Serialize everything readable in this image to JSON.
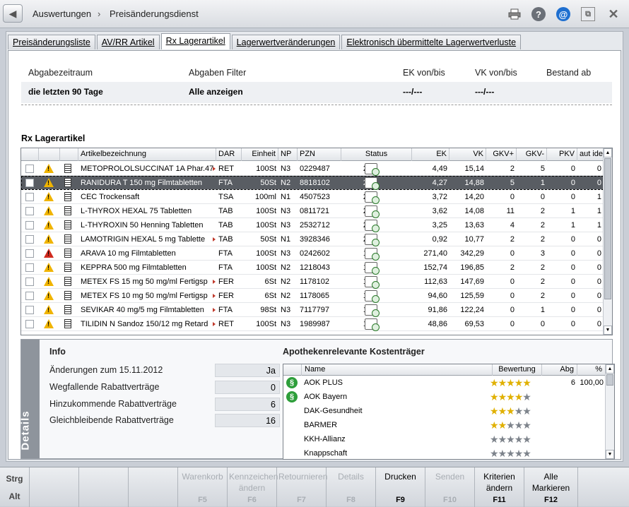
{
  "header": {
    "crumb1": "Auswertungen",
    "separator": "›",
    "crumb2": "Preisänderungsdienst",
    "icons": [
      "printer-icon",
      "help-icon",
      "email-icon",
      "window-icon",
      "close-icon"
    ]
  },
  "tabs": [
    {
      "label": "Preisänderungsliste",
      "active": false
    },
    {
      "label": "AV/RR Artikel",
      "active": false
    },
    {
      "label": "Rx Lagerartikel",
      "active": true
    },
    {
      "label": "Lagerwertveränderungen",
      "active": false
    },
    {
      "label": "Elektronisch übermittelte Lagerwertverluste",
      "active": false
    }
  ],
  "filter": {
    "labels": {
      "zeitraum": "Abgabezeitraum",
      "filter": "Abgaben Filter",
      "ek": "EK von/bis",
      "vk": "VK von/bis",
      "bestand": "Bestand ab"
    },
    "values": {
      "zeitraum": "die letzten 90 Tage",
      "filter": "Alle anzeigen",
      "ek": "---/---",
      "vk": "---/---",
      "bestand": ""
    }
  },
  "section_title": "Rx Lagerartikel",
  "columns": [
    "",
    "",
    "",
    "Artikelbezeichnung",
    "DAR",
    "Einheit",
    "NP",
    "PZN",
    "Status",
    "EK",
    "VK",
    "GKV+",
    "GKV-",
    "PKV",
    "aut idem"
  ],
  "rows": [
    {
      "name": "METOPROLOLSUCCINAT 1A Phar.47",
      "dar": "RET",
      "einheit": "100St",
      "np": "N3",
      "pzn": "0229487",
      "status": "2",
      "ek": "4,49",
      "vk": "15,14",
      "gkvp": "2",
      "gkvm": "5",
      "pkv": "0",
      "autidem": "0",
      "warn": "yellow",
      "truncated": true
    },
    {
      "name": "RANIDURA T 150 mg Filmtabletten",
      "dar": "FTA",
      "einheit": "50St",
      "np": "N2",
      "pzn": "8818102",
      "status": "2",
      "ek": "4,27",
      "vk": "14,88",
      "gkvp": "5",
      "gkvm": "1",
      "pkv": "0",
      "autidem": "0",
      "warn": "yellow",
      "selected": true
    },
    {
      "name": "CEC Trockensaft",
      "dar": "TSA",
      "einheit": "100ml",
      "np": "N1",
      "pzn": "4507523",
      "status": "2",
      "ek": "3,72",
      "vk": "14,20",
      "gkvp": "0",
      "gkvm": "0",
      "pkv": "0",
      "autidem": "1",
      "warn": "yellow"
    },
    {
      "name": "L-THYROX HEXAL 75 Tabletten",
      "dar": "TAB",
      "einheit": "100St",
      "np": "N3",
      "pzn": "0811721",
      "status": "2",
      "ek": "3,62",
      "vk": "14,08",
      "gkvp": "11",
      "gkvm": "2",
      "pkv": "1",
      "autidem": "1",
      "warn": "yellow"
    },
    {
      "name": "L-THYROXIN 50 Henning Tabletten",
      "dar": "TAB",
      "einheit": "100St",
      "np": "N3",
      "pzn": "2532712",
      "status": "2",
      "ek": "3,25",
      "vk": "13,63",
      "gkvp": "4",
      "gkvm": "2",
      "pkv": "1",
      "autidem": "1",
      "warn": "yellow"
    },
    {
      "name": "LAMOTRIGIN HEXAL 5 mg Tablette",
      "dar": "TAB",
      "einheit": "50St",
      "np": "N1",
      "pzn": "3928346",
      "status": "2",
      "ek": "0,92",
      "vk": "10,77",
      "gkvp": "2",
      "gkvm": "2",
      "pkv": "0",
      "autidem": "0",
      "warn": "yellow",
      "truncated": true
    },
    {
      "name": "ARAVA 10 mg Filmtabletten",
      "dar": "FTA",
      "einheit": "100St",
      "np": "N3",
      "pzn": "0242602",
      "status": "1",
      "ek": "271,40",
      "vk": "342,29",
      "gkvp": "0",
      "gkvm": "3",
      "pkv": "0",
      "autidem": "0",
      "warn": "red"
    },
    {
      "name": "KEPPRA 500 mg Filmtabletten",
      "dar": "FTA",
      "einheit": "100St",
      "np": "N2",
      "pzn": "1218043",
      "status": "1",
      "ek": "152,74",
      "vk": "196,85",
      "gkvp": "2",
      "gkvm": "2",
      "pkv": "0",
      "autidem": "0",
      "warn": "yellow"
    },
    {
      "name": "METEX FS 15 mg 50 mg/ml Fertigsp",
      "dar": "FER",
      "einheit": "6St",
      "np": "N2",
      "pzn": "1178102",
      "status": "1",
      "ek": "112,63",
      "vk": "147,69",
      "gkvp": "0",
      "gkvm": "2",
      "pkv": "0",
      "autidem": "0",
      "warn": "yellow",
      "truncated": true
    },
    {
      "name": "METEX FS 10 mg 50 mg/ml Fertigsp",
      "dar": "FER",
      "einheit": "6St",
      "np": "N2",
      "pzn": "1178065",
      "status": "1",
      "ek": "94,60",
      "vk": "125,59",
      "gkvp": "0",
      "gkvm": "2",
      "pkv": "0",
      "autidem": "0",
      "warn": "yellow",
      "truncated": true
    },
    {
      "name": "SEVIKAR 40 mg/5 mg Filmtabletten",
      "dar": "FTA",
      "einheit": "98St",
      "np": "N3",
      "pzn": "7117797",
      "status": "1",
      "ek": "91,86",
      "vk": "122,24",
      "gkvp": "0",
      "gkvm": "1",
      "pkv": "0",
      "autidem": "0",
      "warn": "yellow",
      "truncated": true
    },
    {
      "name": "TILIDIN N Sandoz 150/12 mg Retard",
      "dar": "RET",
      "einheit": "100St",
      "np": "N3",
      "pzn": "1989987",
      "status": "1",
      "ek": "48,86",
      "vk": "69,53",
      "gkvp": "0",
      "gkvm": "0",
      "pkv": "0",
      "autidem": "0",
      "warn": "yellow",
      "truncated": true
    }
  ],
  "details": {
    "side_label": "Details",
    "info_title": "Info",
    "items": [
      {
        "label": "Änderungen zum 15.11.2012",
        "value": "Ja"
      },
      {
        "label": "Wegfallende Rabattverträge",
        "value": "0"
      },
      {
        "label": "Hinzukommende Rabattverträge",
        "value": "6"
      },
      {
        "label": "Gleichbleibende Rabattverträge",
        "value": "16"
      }
    ],
    "kt_title": "Apothekenrelevante Kostenträger",
    "kt_columns": [
      "",
      "Name",
      "Bewertung",
      "Abg",
      "%"
    ],
    "kt_rows": [
      {
        "name": "AOK PLUS",
        "stars": 5,
        "abg": "6",
        "pct": "100,00",
        "icon": true
      },
      {
        "name": "AOK Bayern",
        "stars": 4,
        "abg": "",
        "pct": "",
        "icon": true
      },
      {
        "name": "DAK-Gesundheit",
        "stars": 3,
        "abg": "",
        "pct": "",
        "icon": false
      },
      {
        "name": "BARMER",
        "stars": 2,
        "abg": "",
        "pct": "",
        "icon": false
      },
      {
        "name": "KKH-Allianz",
        "stars": 0,
        "abg": "",
        "pct": "",
        "icon": false
      },
      {
        "name": "Knappschaft",
        "stars": 0,
        "abg": "",
        "pct": "",
        "icon": false
      }
    ]
  },
  "fkeys": [
    {
      "label": "Warenkorb",
      "key": "F5",
      "disabled": true
    },
    {
      "label": "Kennzeichen ändern",
      "key": "F6",
      "disabled": true
    },
    {
      "label": "Retournieren",
      "key": "F7",
      "disabled": true
    },
    {
      "label": "Details",
      "key": "F8",
      "disabled": true
    },
    {
      "label": "Drucken",
      "key": "F9",
      "disabled": false
    },
    {
      "label": "Senden",
      "key": "F10",
      "disabled": true
    },
    {
      "label": "Kriterien ändern",
      "key": "F11",
      "disabled": false
    },
    {
      "label": "Alle Markieren",
      "key": "F12",
      "disabled": false
    }
  ],
  "modifiers": {
    "strg": "Strg",
    "alt": "Alt"
  }
}
